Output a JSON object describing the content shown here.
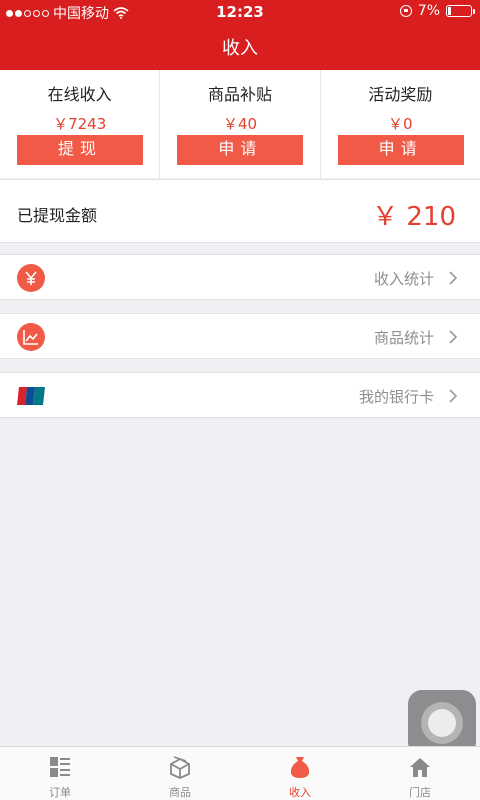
{
  "status_bar": {
    "carrier": "中国移动",
    "time": "12:23",
    "battery": "7%"
  },
  "nav": {
    "title": "收入"
  },
  "income": [
    {
      "title": "在线收入",
      "value": "￥7243",
      "button": "提现"
    },
    {
      "title": "商品补贴",
      "value": "￥40",
      "button": "申请"
    },
    {
      "title": "活动奖励",
      "value": "￥0",
      "button": "申请"
    }
  ],
  "withdrawn": {
    "label": "已提现金额",
    "value": "￥ 210"
  },
  "menu": [
    {
      "label": "收入统计",
      "icon": "yen-icon"
    },
    {
      "label": "商品统计",
      "icon": "chart-icon"
    },
    {
      "label": "我的银行卡",
      "icon": "unionpay-icon"
    }
  ],
  "tabs": [
    {
      "label": "订单",
      "icon": "order-list-icon",
      "active": false
    },
    {
      "label": "商品",
      "icon": "goods-box-icon",
      "active": false
    },
    {
      "label": "收入",
      "icon": "money-bag-icon",
      "active": true
    },
    {
      "label": "门店",
      "icon": "store-house-icon",
      "active": false
    }
  ],
  "colors": {
    "header": "#d81e1e",
    "accent": "#f05a46",
    "price": "#e4402f",
    "background": "#efeff4"
  }
}
